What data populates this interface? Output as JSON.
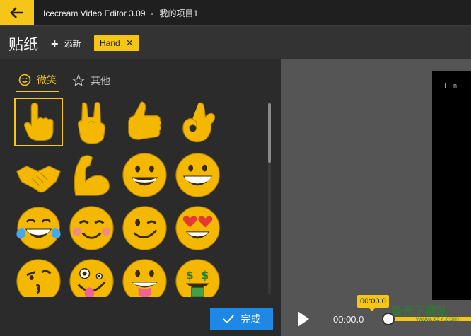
{
  "titlebar": {
    "app_name": "Icecream Video Editor 3.09",
    "separator": "-",
    "project_name": "我的项目1"
  },
  "toolbar": {
    "panel_title": "贴纸",
    "add_label": "添新",
    "filter_tag": "Hand"
  },
  "tabs": [
    {
      "label": "微笑",
      "icon": "smiley-icon",
      "active": true
    },
    {
      "label": "其他",
      "icon": "star-icon",
      "active": false
    }
  ],
  "stickers": [
    {
      "name": "pointing-hand",
      "selected": true
    },
    {
      "name": "rock-on-hand"
    },
    {
      "name": "thumbs-up"
    },
    {
      "name": "ok-hand"
    },
    {
      "name": "handshake"
    },
    {
      "name": "flexed-biceps"
    },
    {
      "name": "grinning-face"
    },
    {
      "name": "beaming-face"
    },
    {
      "name": "tears-of-joy-face"
    },
    {
      "name": "smiling-blush-face"
    },
    {
      "name": "winking-face"
    },
    {
      "name": "heart-eyes-face"
    },
    {
      "name": "kissing-wink-face"
    },
    {
      "name": "zany-face"
    },
    {
      "name": "tongue-out-face"
    },
    {
      "name": "money-mouth-face"
    }
  ],
  "done_button": {
    "label": "完成"
  },
  "player": {
    "current_time": "00:00.0",
    "bubble_time": "00:00.0",
    "video_overlay_text": "- l·· ·--n· ·-·"
  },
  "watermark": {
    "text": "极光下载站",
    "sub": "www.xz7.com"
  },
  "colors": {
    "accent": "#f5c518",
    "button_blue": "#1e88e5"
  }
}
